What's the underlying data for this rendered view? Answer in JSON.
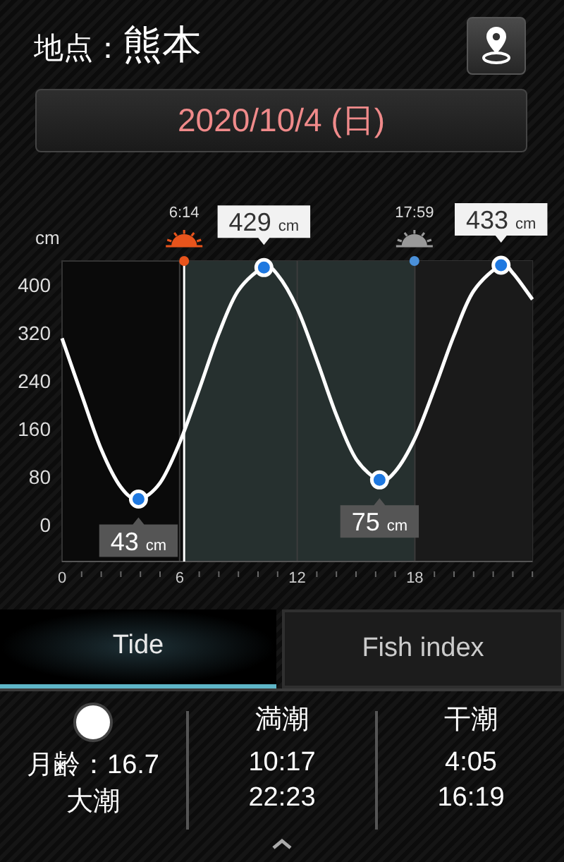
{
  "header": {
    "label": "地点：",
    "location": "熊本"
  },
  "date_button": {
    "label": "2020/10/4 (日)"
  },
  "chart": {
    "sun_events": [
      {
        "kind": "sunrise",
        "time": "6:14"
      },
      {
        "kind": "sunset",
        "time": "17:59"
      }
    ],
    "chart_data": {
      "type": "line",
      "ylabel": "cm",
      "x": [
        0,
        1,
        2,
        3,
        3.9,
        5,
        6,
        7,
        8,
        9,
        10.3,
        11,
        12,
        13,
        14,
        15,
        16.2,
        17,
        18,
        19,
        20,
        21,
        22.4,
        23,
        24
      ],
      "series": [
        {
          "color": "#ffffff",
          "values": [
            311,
            217,
            126,
            63,
            43,
            70,
            137,
            226,
            319,
            391,
            429,
            417,
            361,
            275,
            183,
            110,
            75,
            89,
            144,
            227,
            316,
            390,
            433,
            420,
            376
          ]
        }
      ],
      "xlim": [
        0,
        24
      ],
      "ylim": [
        -61,
        440
      ],
      "xticks": [
        0,
        6,
        12,
        18
      ],
      "yticks": [
        0,
        80,
        160,
        240,
        320,
        400
      ],
      "grid": true,
      "bands": [
        {
          "axis": "x",
          "from": 6.23,
          "to": 17.98,
          "color": "#26302f"
        },
        {
          "axis": "x",
          "from": 17.98,
          "to": 24,
          "color": "#1a1a1a"
        }
      ],
      "ref_lines": [
        {
          "axis": "x",
          "value": 6.23,
          "color": "#ffffff"
        }
      ],
      "annotations": [
        {
          "x": 3.9,
          "y": 43,
          "text": "43 cm"
        },
        {
          "x": 10.3,
          "y": 429,
          "text": "429 cm"
        },
        {
          "x": 16.2,
          "y": 75,
          "text": "75 cm"
        },
        {
          "x": 22.4,
          "y": 433,
          "text": "433 cm"
        }
      ]
    }
  },
  "tabs": [
    {
      "label": "Tide",
      "selected": true
    },
    {
      "label": "Fish index",
      "selected": false
    }
  ],
  "moon": {
    "age": "月齢：16.7",
    "tide_type": "大潮"
  },
  "tide_columns": [
    {
      "heading": "満潮",
      "times": [
        "10:17",
        "22:23"
      ]
    },
    {
      "heading": "干潮",
      "times": [
        "4:05",
        "16:19"
      ]
    }
  ]
}
